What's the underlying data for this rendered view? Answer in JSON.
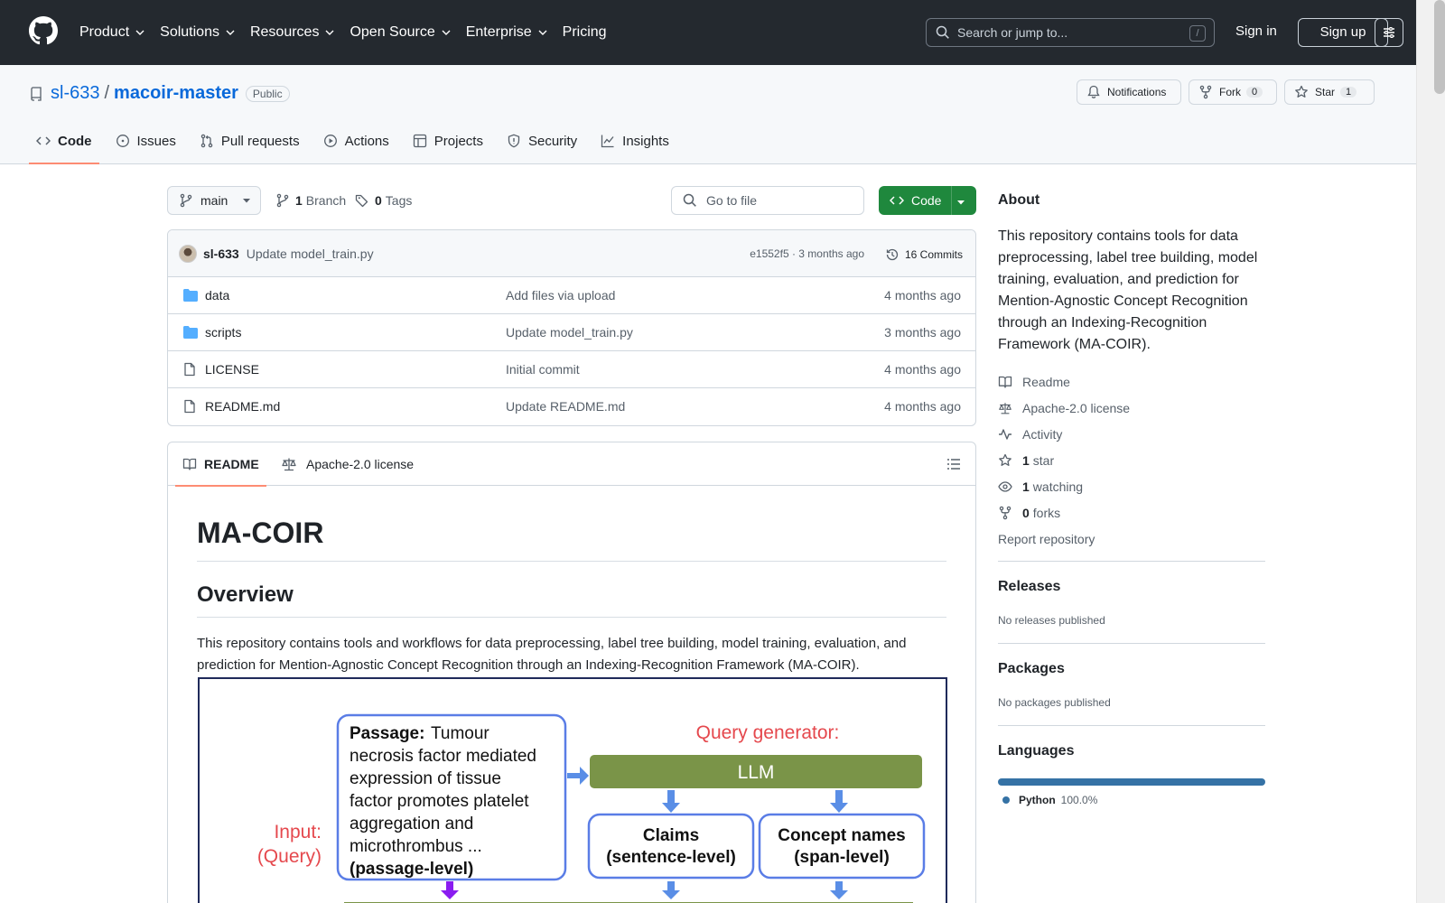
{
  "header": {
    "nav": [
      "Product",
      "Solutions",
      "Resources",
      "Open Source",
      "Enterprise",
      "Pricing"
    ],
    "search_placeholder": "Search or jump to...",
    "search_key": "/",
    "signin": "Sign in",
    "signup": "Sign up"
  },
  "repo": {
    "owner": "sl-633",
    "separator": "/",
    "name": "macoir-master",
    "visibility": "Public",
    "notifications": "Notifications",
    "fork_label": "Fork",
    "fork_count": "0",
    "star_label": "Star",
    "star_count": "1",
    "tabs": [
      "Code",
      "Issues",
      "Pull requests",
      "Actions",
      "Projects",
      "Security",
      "Insights"
    ]
  },
  "toolbar": {
    "branch": "main",
    "branch_count": "1",
    "branch_label": "Branch",
    "tag_count": "0",
    "tag_label": "Tags",
    "goto_file": "Go to file",
    "code_button": "Code"
  },
  "commit": {
    "author": "sl-633",
    "message": "Update model_train.py",
    "hash_time": "e1552f5 · 3 months ago",
    "commits": "16 Commits"
  },
  "files": [
    {
      "name": "data",
      "type": "folder",
      "message": "Add files via upload",
      "date": "4 months ago"
    },
    {
      "name": "scripts",
      "type": "folder",
      "message": "Update model_train.py",
      "date": "3 months ago"
    },
    {
      "name": "LICENSE",
      "type": "file",
      "message": "Initial commit",
      "date": "4 months ago"
    },
    {
      "name": "README.md",
      "type": "file",
      "message": "Update README.md",
      "date": "4 months ago"
    }
  ],
  "readme": {
    "tab_readme": "README",
    "tab_license": "Apache-2.0 license",
    "h1": "MA-COIR",
    "h2": "Overview",
    "paragraph": "This repository contains tools and workflows for data preprocessing, label tree building, model training, evaluation, and prediction for Mention-Agnostic Concept Recognition through an Indexing-Recognition Framework (MA-COIR).",
    "diagram": {
      "passage_label": "Passage:",
      "passage_lines": [
        "Tumour",
        "necrosis factor mediated",
        "expression of tissue",
        "factor promotes platelet",
        "aggregation and",
        "microthrombus ..."
      ],
      "passage_level": "(passage-level)",
      "input_label": "Input:",
      "query_label": "(Query)",
      "query_generator": "Query generator:",
      "llm": "LLM",
      "claims": "Claims",
      "claims_level": "(sentence-level)",
      "concept_names": "Concept names",
      "concept_level": "(span-level)"
    }
  },
  "sidebar": {
    "about_heading": "About",
    "about_text": "This repository contains tools for data preprocessing, label tree building, model training, evaluation, and prediction for Mention-Agnostic Concept Recognition through an Indexing-Recognition Framework (MA-COIR).",
    "readme": "Readme",
    "license": "Apache-2.0 license",
    "activity": "Activity",
    "stars_count": "1",
    "stars_label": "star",
    "watching_count": "1",
    "watching_label": "watching",
    "forks_count": "0",
    "forks_label": "forks",
    "report": "Report repository",
    "releases_heading": "Releases",
    "releases_text": "No releases published",
    "packages_heading": "Packages",
    "packages_text": "No packages published",
    "languages_heading": "Languages",
    "language_name": "Python",
    "language_pct": "100.0%",
    "language_fraction": 1.0
  },
  "colors": {
    "header_bg": "#24292f",
    "link": "#0969da",
    "primary_button": "#1f883d",
    "tab_underline": "#fd8c73",
    "python": "#3572A5",
    "folder": "#54aeff"
  }
}
